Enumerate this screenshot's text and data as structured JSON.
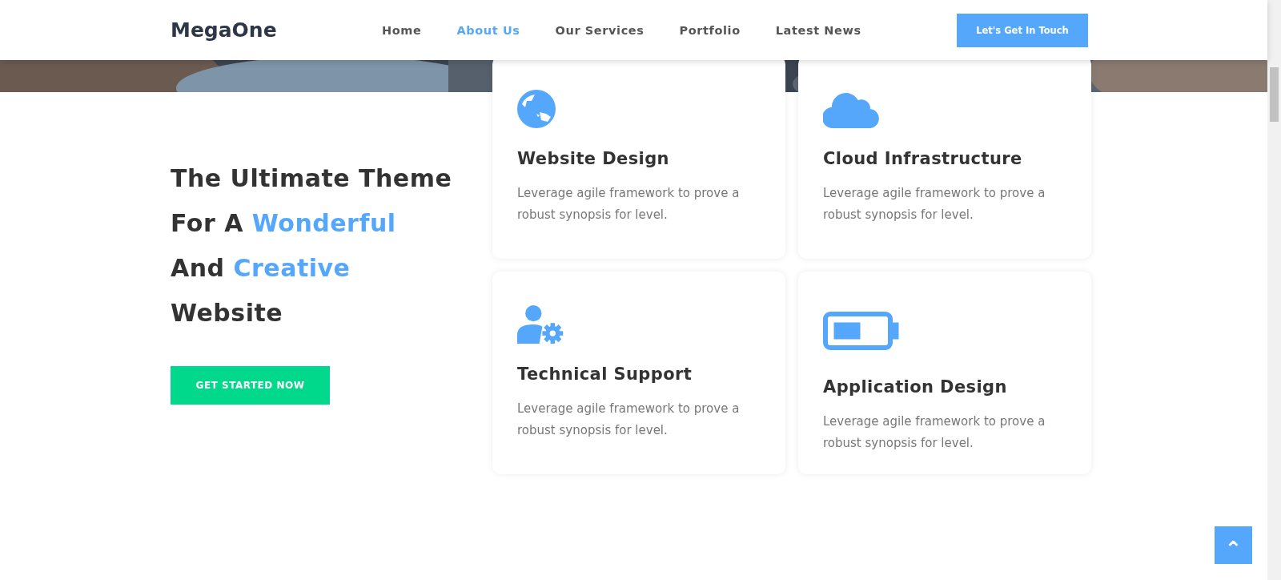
{
  "header": {
    "logo": "MegaOne",
    "nav": [
      {
        "label": "Home",
        "selected": false
      },
      {
        "label": "About Us",
        "selected": true
      },
      {
        "label": "Our Services",
        "selected": false
      },
      {
        "label": "Portfolio",
        "selected": false
      },
      {
        "label": "Latest News",
        "selected": false
      }
    ],
    "cta": "Let's Get In Touch"
  },
  "hero": {
    "kind": "picture"
  },
  "headline": [
    [
      {
        "text": "The Ultimate Theme",
        "highlight": false
      }
    ],
    [
      {
        "text": "For A ",
        "highlight": false
      },
      {
        "text": "Wonderful",
        "highlight": true
      }
    ],
    [
      {
        "text": "And ",
        "highlight": false
      },
      {
        "text": "Creative",
        "highlight": true
      }
    ],
    [
      {
        "text": "Website",
        "highlight": false
      }
    ]
  ],
  "start_button": "GET STARTED NOW",
  "cards": [
    {
      "title": "Website Design",
      "text": "Leverage agile framework to prove a robust synopsis for level."
    },
    {
      "title": "Cloud Infrastructure",
      "text": "Leverage agile framework to prove a robust synopsis for level."
    },
    {
      "title": "Technical Support",
      "text": "Leverage agile framework to prove a robust synopsis for level."
    },
    {
      "title": "Application Design",
      "text": "Leverage agile framework to prove a robust synopsis for level."
    }
  ],
  "back_to_top": "⌃"
}
